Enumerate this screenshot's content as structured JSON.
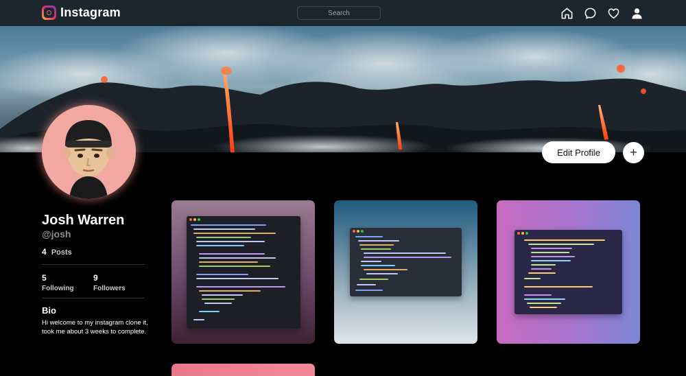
{
  "nav": {
    "brand_name": "Instagram",
    "search_placeholder": "Search",
    "icons": [
      "home-icon",
      "messages-icon",
      "heart-icon",
      "user-icon"
    ]
  },
  "profile": {
    "name": "Josh Warren",
    "handle": "@josh",
    "posts_count": "4",
    "posts_label": "Posts",
    "following_count": "5",
    "following_label": "Following",
    "followers_count": "9",
    "followers_label": "Followers",
    "bio_title": "Bio",
    "bio_text": "Hi welcome to my instagram clone it, took me about 3 weeks to complete."
  },
  "actions": {
    "edit_profile": "Edit Profile",
    "add": "+"
  },
  "colors": {
    "nav_bg": "#1c262f",
    "page_bg": "#000000",
    "lava": "#ff4a1c",
    "avatar_bg": "#f0a8a0"
  }
}
